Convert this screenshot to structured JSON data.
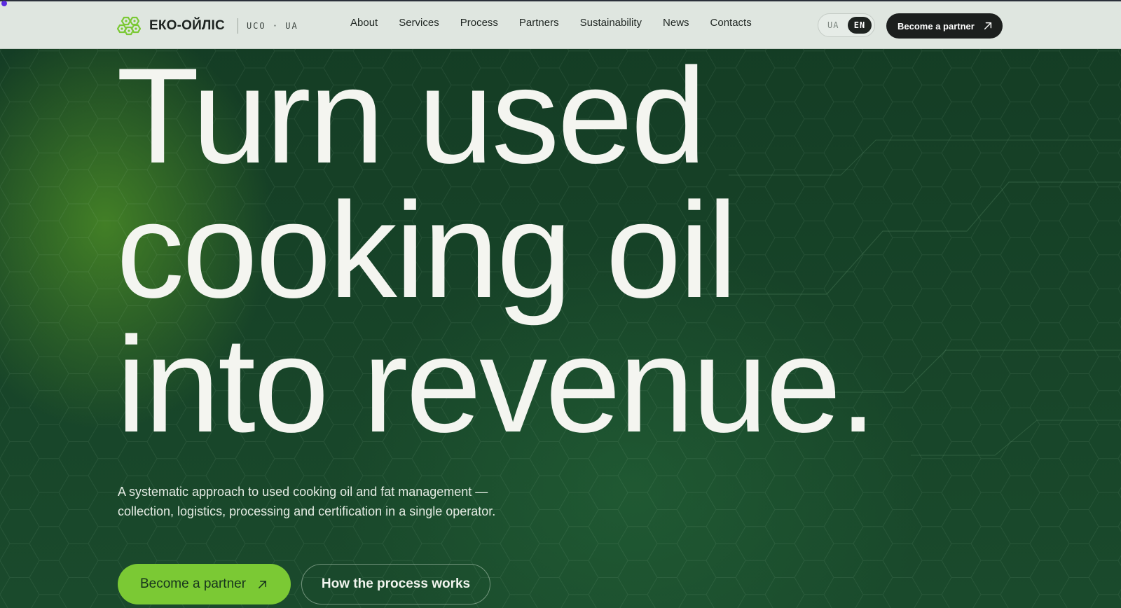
{
  "brand": {
    "name": "ЕКО-ОЙЛІС",
    "tag": "UCO · UA",
    "logo_icon": "molecule-logo-icon",
    "accent_color": "#7bc934"
  },
  "nav": {
    "items": [
      {
        "label": "About"
      },
      {
        "label": "Services"
      },
      {
        "label": "Process"
      },
      {
        "label": "Partners"
      },
      {
        "label": "Sustainability"
      },
      {
        "label": "News"
      },
      {
        "label": "Contacts"
      }
    ]
  },
  "language": {
    "options": [
      "UA",
      "EN"
    ],
    "selected": "EN"
  },
  "header_cta": {
    "label": "Become a partner",
    "icon": "arrow-up-right-icon"
  },
  "hero": {
    "headline_lines": [
      "Turn used",
      "cooking oil",
      "into revenue."
    ],
    "subtitle_lines": [
      "A systematic approach to used cooking oil and fat management —",
      "collection, logistics, processing and certification in a single operator."
    ],
    "primary_cta": {
      "label": "Become a partner",
      "icon": "arrow-up-right-icon"
    },
    "secondary_cta": {
      "label": "How the process works"
    },
    "background_color": "#143f26",
    "text_color": "#f4f5f0"
  }
}
